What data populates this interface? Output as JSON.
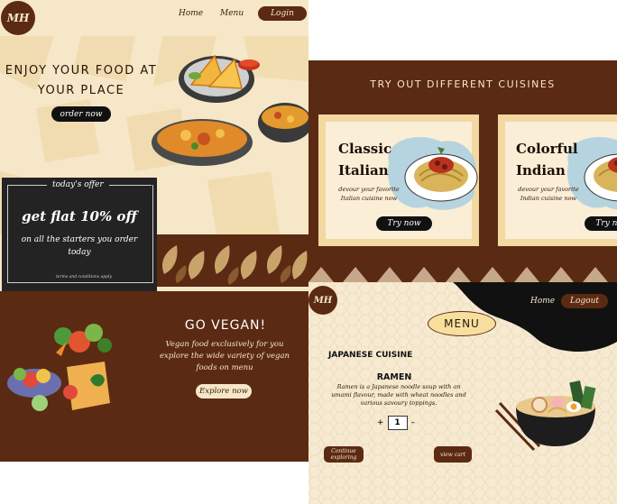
{
  "home": {
    "logo": "MH",
    "nav": {
      "home": "Home",
      "menu": "Menu",
      "login": "Login"
    },
    "hero": {
      "line1": "ENJOY YOUR FOOD AT",
      "line2": "YOUR PLACE",
      "cta": "order now"
    },
    "offer": {
      "heading": "today's offer",
      "title": "get flat 10% off",
      "subtitle": "on all the starters you order today",
      "note": "terms and conditions apply"
    },
    "vegan": {
      "title": "GO VEGAN!",
      "text": "Vegan food exclusively for you explore the wide variety of vegan foods on menu",
      "cta": "Explore now"
    }
  },
  "cuisines": {
    "title": "TRY OUT DIFFERENT CUISINES",
    "cards": [
      {
        "line1": "Classic",
        "line2": "Italian",
        "desc": "devour your favorite Italian cuisine now",
        "button": "Try now"
      },
      {
        "line1": "Colorful",
        "line2": "Indian",
        "desc": "devour your favorite Indian cuisine now",
        "button": "Try now"
      }
    ]
  },
  "menu_page": {
    "logo": "MH",
    "nav": {
      "home": "Home",
      "logout": "Logout"
    },
    "badge": "MENU",
    "category": "JAPANESE CUISINE",
    "dish": {
      "name": "RAMEN",
      "description": "Ramen is a Japanese noodle soup with an umami flavour, made with wheat noodles and various savoury toppings."
    },
    "stepper": {
      "plus": "+",
      "quantity": "1",
      "minus": "–"
    },
    "buttons": {
      "continue": "Continue exploring",
      "view_cart": "view cart"
    }
  },
  "colors": {
    "brown": "#5b2a13",
    "cream": "#f6e7c8",
    "black": "#111111",
    "gold": "#f2d9a1"
  }
}
